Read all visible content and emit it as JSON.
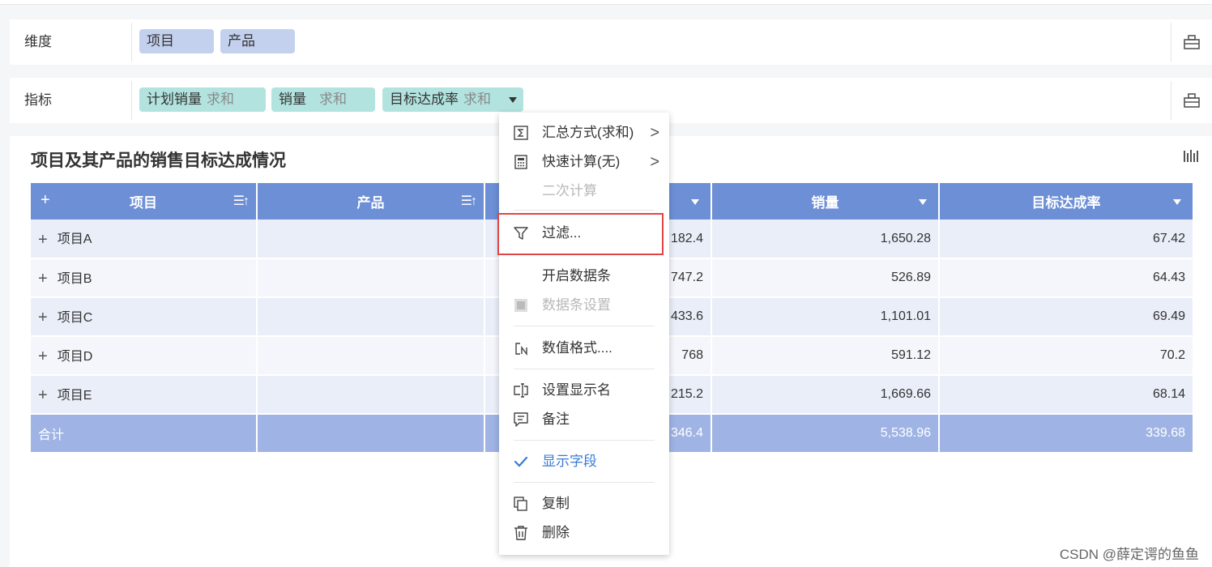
{
  "dimension_row": {
    "label": "维度",
    "pills": [
      "项目",
      "产品"
    ]
  },
  "indicator_row": {
    "label": "指标",
    "pills": [
      {
        "name": "计划销量",
        "agg": "求和"
      },
      {
        "name": "销量",
        "agg": "求和"
      },
      {
        "name": "目标达成率",
        "agg": "求和"
      }
    ]
  },
  "panel": {
    "title": "项目及其产品的销售目标达成情况"
  },
  "table": {
    "headers": {
      "plus": "+",
      "col1": "项目",
      "col2": "产品",
      "col4": "销量",
      "col5": "目标达成率",
      "sort": "☰↑"
    },
    "rows": [
      {
        "plus": "+",
        "name": "项目A",
        "plan": "182.4",
        "sales": "1,650.28",
        "rate": "67.42"
      },
      {
        "plus": "+",
        "name": "项目B",
        "plan": "747.2",
        "sales": "526.89",
        "rate": "64.43"
      },
      {
        "plus": "+",
        "name": "项目C",
        "plan": "433.6",
        "sales": "1,101.01",
        "rate": "69.49"
      },
      {
        "plus": "+",
        "name": "项目D",
        "plan": "768",
        "sales": "591.12",
        "rate": "70.2"
      },
      {
        "plus": "+",
        "name": "项目E",
        "plan": "215.2",
        "sales": "1,669.66",
        "rate": "68.14"
      }
    ],
    "total": {
      "label": "合计",
      "plan": "346.4",
      "sales": "5,538.96",
      "rate": "339.68"
    }
  },
  "menu": {
    "items": [
      {
        "label": "汇总方式(求和)",
        "icon": "sigma-icon",
        "arrow": ">"
      },
      {
        "label": "快速计算(无)",
        "icon": "calculator-icon",
        "arrow": ">"
      },
      {
        "label": "二次计算",
        "disabled": true
      },
      {
        "label": "过滤...",
        "icon": "filter-icon",
        "highlighted": true
      },
      {
        "label": "开启数据条"
      },
      {
        "label": "数据条设置",
        "icon": "databar-icon",
        "disabled": true
      },
      {
        "label": "数值格式....",
        "icon": "number-format-icon"
      },
      {
        "label": "设置显示名",
        "icon": "rename-icon"
      },
      {
        "label": "备注",
        "icon": "comment-icon"
      },
      {
        "label": "显示字段",
        "icon": "check-icon",
        "active": true
      },
      {
        "label": "复制",
        "icon": "copy-icon"
      },
      {
        "label": "删除",
        "icon": "trash-icon"
      }
    ]
  },
  "watermark": "CSDN @薛定谔的鱼鱼",
  "colors": {
    "header": "#6d8fd6",
    "total": "#9fb4e4",
    "dim_pill": "#c3d0ee",
    "ind_pill": "#b2e3df",
    "highlight": "#e04545",
    "active": "#3a7bd5"
  }
}
